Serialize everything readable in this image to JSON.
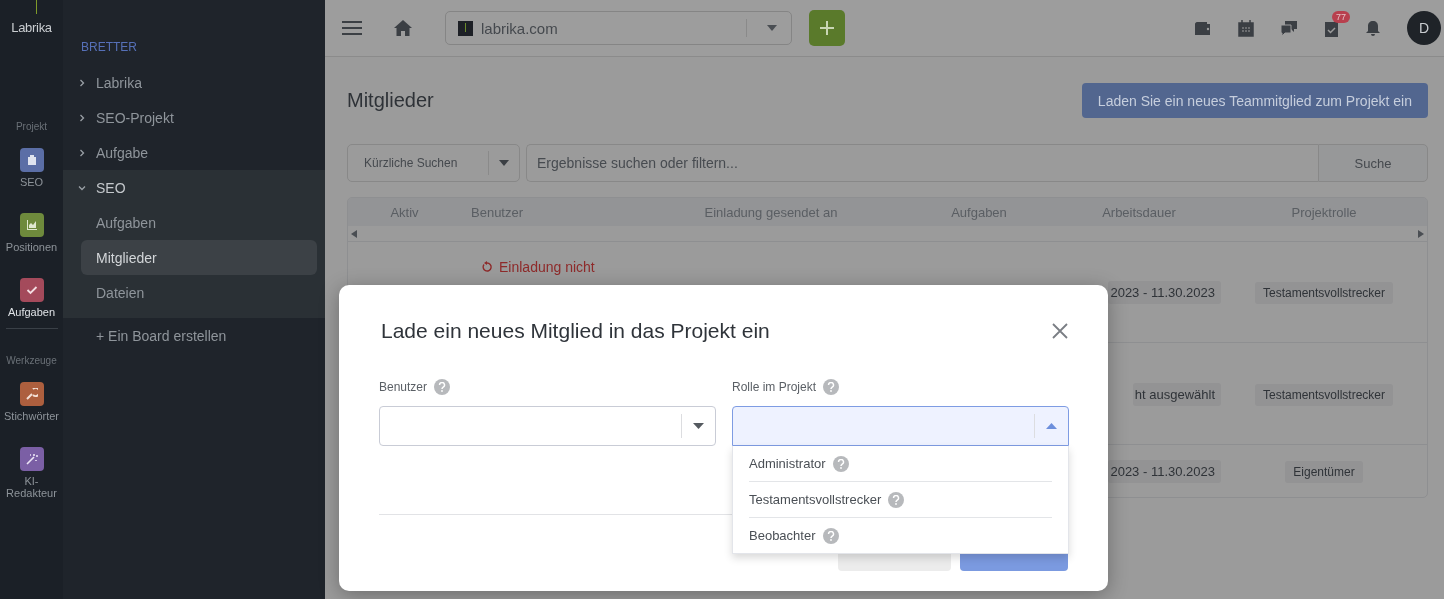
{
  "rail": {
    "logo": "Labrika",
    "sections": [
      {
        "label": "Projekt",
        "items": [
          {
            "label": "SEO",
            "active": false,
            "color": "#5b6ea6"
          },
          {
            "label": "Positionen",
            "active": false,
            "color": "#6e8a3c"
          },
          {
            "label": "Aufgaben",
            "active": true,
            "color": "#a44a5b"
          }
        ]
      },
      {
        "label": "Werkzeuge",
        "items": [
          {
            "label": "Stichwörter",
            "active": false,
            "color": "#ad5f3e"
          },
          {
            "label": "KI-Redakteur",
            "active": false,
            "color": "#7b5fa5"
          }
        ]
      }
    ]
  },
  "sidebar": {
    "heading": "BRETTER",
    "boards": [
      {
        "label": "Labrika",
        "expanded": false
      },
      {
        "label": "SEO-Projekt",
        "expanded": false
      },
      {
        "label": "Aufgabe",
        "expanded": false
      },
      {
        "label": "SEO",
        "expanded": true,
        "children": [
          {
            "label": "Aufgaben",
            "selected": false
          },
          {
            "label": "Mitglieder",
            "selected": true
          },
          {
            "label": "Dateien",
            "selected": false
          }
        ]
      }
    ],
    "create": "+ Ein Board erstellen"
  },
  "topbar": {
    "domain": "labrika.com",
    "tasks_badge": "77",
    "avatar": "D"
  },
  "page": {
    "title": "Mitglieder",
    "invite_button": "Laden Sie ein neues Teammitglied zum Projekt ein",
    "search": {
      "recent": "Kürzliche Suchen",
      "placeholder": "Ergebnisse suchen oder filtern...",
      "button": "Suche"
    },
    "table": {
      "columns": [
        "Aktiv",
        "Benutzer",
        "Einladung gesendet an",
        "Aufgaben",
        "Arbeitsdauer",
        "Projektrolle"
      ],
      "rows": [
        {
          "status": "Einladung nicht",
          "duration": "2023 - 11.30.2023",
          "role": "Testamentsvollstrecker"
        },
        {
          "duration": "ht ausgewählt",
          "role": "Testamentsvollstrecker"
        },
        {
          "duration": "2023 - 11.30.2023",
          "role": "Eigentümer"
        }
      ]
    }
  },
  "modal": {
    "title": "Lade ein neues Mitglied in das Projekt ein",
    "fields": [
      {
        "label": "Benutzer",
        "open": false
      },
      {
        "label": "Rolle im Projekt",
        "open": true,
        "options": [
          "Administrator",
          "Testamentsvollstrecker",
          "Beobachter"
        ]
      }
    ]
  }
}
